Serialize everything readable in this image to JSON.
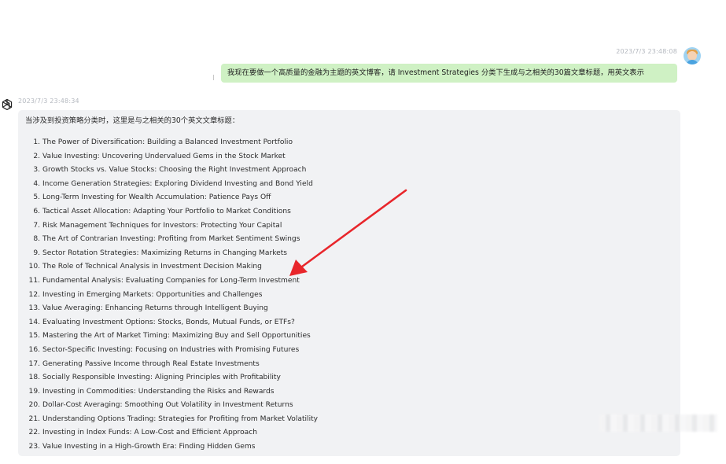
{
  "user_message": {
    "timestamp": "2023/7/3 23:48:08",
    "text": "我现在要做一个高质量的金融为主题的英文博客，请 Investment Strategies 分类下生成与之相关的30篇文章标题，用英文表示"
  },
  "assistant_message": {
    "timestamp": "2023/7/3 23:48:34",
    "intro": "当涉及到投资策略分类时，这里是与之相关的30个英文文章标题：",
    "items": [
      {
        "num": "1.",
        "text": "The Power of Diversification: Building a Balanced Investment Portfolio"
      },
      {
        "num": "2.",
        "text": "Value Investing: Uncovering Undervalued Gems in the Stock Market"
      },
      {
        "num": "3.",
        "text": "Growth Stocks vs. Value Stocks: Choosing the Right Investment Approach"
      },
      {
        "num": "4.",
        "text": "Income Generation Strategies: Exploring Dividend Investing and Bond Yield"
      },
      {
        "num": "5.",
        "text": "Long-Term Investing for Wealth Accumulation: Patience Pays Off"
      },
      {
        "num": "6.",
        "text": "Tactical Asset Allocation: Adapting Your Portfolio to Market Conditions"
      },
      {
        "num": "7.",
        "text": "Risk Management Techniques for Investors: Protecting Your Capital"
      },
      {
        "num": "8.",
        "text": "The Art of Contrarian Investing: Profiting from Market Sentiment Swings"
      },
      {
        "num": "9.",
        "text": "Sector Rotation Strategies: Maximizing Returns in Changing Markets"
      },
      {
        "num": "10.",
        "text": "The Role of Technical Analysis in Investment Decision Making"
      },
      {
        "num": "11.",
        "text": "Fundamental Analysis: Evaluating Companies for Long-Term Investment"
      },
      {
        "num": "12.",
        "text": "Investing in Emerging Markets: Opportunities and Challenges"
      },
      {
        "num": "13.",
        "text": "Value Averaging: Enhancing Returns through Intelligent Buying"
      },
      {
        "num": "14.",
        "text": "Evaluating Investment Options: Stocks, Bonds, Mutual Funds, or ETFs?"
      },
      {
        "num": "15.",
        "text": "Mastering the Art of Market Timing: Maximizing Buy and Sell Opportunities"
      },
      {
        "num": "16.",
        "text": "Sector-Specific Investing: Focusing on Industries with Promising Futures"
      },
      {
        "num": "17.",
        "text": "Generating Passive Income through Real Estate Investments"
      },
      {
        "num": "18.",
        "text": "Socially Responsible Investing: Aligning Principles with Profitability"
      },
      {
        "num": "19.",
        "text": "Investing in Commodities: Understanding the Risks and Rewards"
      },
      {
        "num": "20.",
        "text": "Dollar-Cost Averaging: Smoothing Out Volatility in Investment Returns"
      },
      {
        "num": "21.",
        "text": "Understanding Options Trading: Strategies for Profiting from Market Volatility"
      },
      {
        "num": "22.",
        "text": "Investing in Index Funds: A Low-Cost and Efficient Approach"
      },
      {
        "num": "23.",
        "text": "Value Investing in a High-Growth Era: Finding Hidden Gems"
      }
    ]
  },
  "icons": {
    "user_avatar": "user-avatar-icon",
    "assistant_logo": "openai-logo-icon"
  },
  "colors": {
    "user_bubble": "#cff1c4",
    "assistant_bubble": "#f1f2f4",
    "annotation_arrow": "#e8262b",
    "timestamp": "#b4b8bf"
  }
}
